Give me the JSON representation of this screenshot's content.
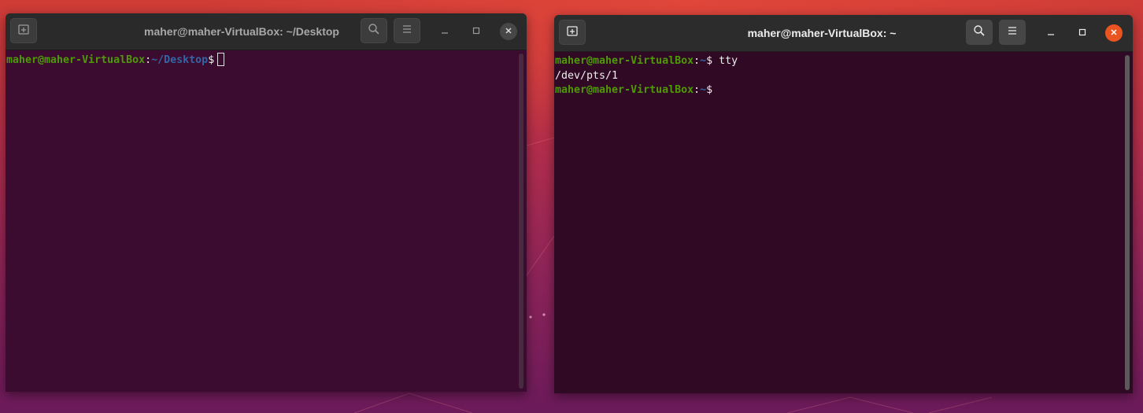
{
  "colors": {
    "user_host": "#4e9a06",
    "path": "#3465a4",
    "left_terminal_bg": "#3b0c2f",
    "right_terminal_bg": "#300a24",
    "close_active": "#e95420"
  },
  "windows": {
    "left": {
      "title": "maher@maher-VirtualBox: ~/Desktop",
      "prompt_user": "maher@maher-VirtualBox",
      "prompt_colon": ":",
      "prompt_path": "~/Desktop",
      "prompt_symbol": "$",
      "icons": [
        "new-tab-icon",
        "search-icon",
        "menu-icon",
        "minimize-icon",
        "maximize-icon",
        "close-icon"
      ]
    },
    "right": {
      "title": "maher@maher-VirtualBox: ~",
      "lines": [
        {
          "user": "maher@maher-VirtualBox",
          "colon": ":",
          "path": "~",
          "symbol": "$ ",
          "command": "tty"
        },
        {
          "output": "/dev/pts/1"
        },
        {
          "user": "maher@maher-VirtualBox",
          "colon": ":",
          "path": "~",
          "symbol": "$",
          "command": ""
        }
      ],
      "icons": [
        "new-tab-icon",
        "search-icon",
        "menu-icon",
        "minimize-icon",
        "maximize-icon",
        "close-icon"
      ]
    }
  }
}
